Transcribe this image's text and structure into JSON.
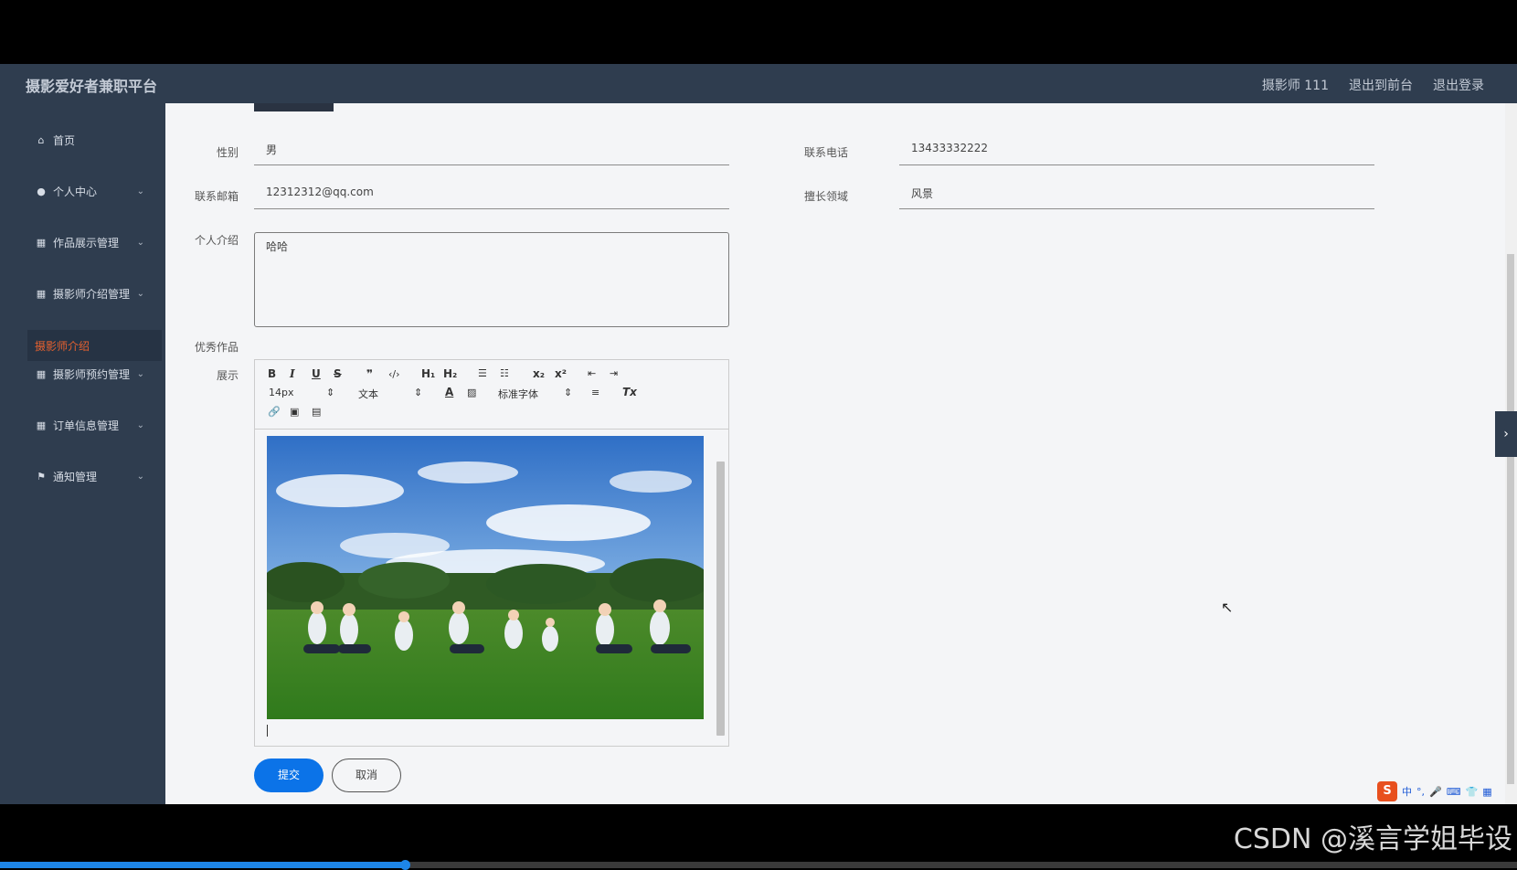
{
  "header": {
    "brand": "摄影爱好者兼职平台",
    "user": "摄影师 111",
    "to_front": "退出到前台",
    "logout": "退出登录"
  },
  "sidebar": {
    "items": [
      {
        "label": "首页",
        "icon": "home-icon"
      },
      {
        "label": "个人中心",
        "icon": "user-icon"
      },
      {
        "label": "作品展示管理",
        "icon": "grid-icon"
      },
      {
        "label": "摄影师介绍管理",
        "icon": "grid-icon"
      },
      {
        "label": "摄影师预约管理",
        "icon": "grid-icon"
      },
      {
        "label": "订单信息管理",
        "icon": "grid-icon"
      },
      {
        "label": "通知管理",
        "icon": "flag-icon"
      }
    ],
    "active_sub": "摄影师介绍"
  },
  "form": {
    "gender_label": "性别",
    "gender_value": "男",
    "phone_label": "联系电话",
    "phone_value": "13433332222",
    "email_label": "联系邮箱",
    "email_value": "12312312@qq.com",
    "field_label": "擅长领域",
    "field_value": "风景",
    "intro_label": "个人介绍",
    "intro_value": "哈哈",
    "works_label_1": "优秀作品",
    "works_label_2": "展示"
  },
  "editor": {
    "font_size": "14px",
    "block_format": "文本",
    "font_family": "标准字体"
  },
  "actions": {
    "submit": "提交",
    "cancel": "取消"
  },
  "overlay": {
    "watermark": "CSDN @溪言学姐毕设",
    "ime_char": "中"
  },
  "video_progress": 0.267
}
